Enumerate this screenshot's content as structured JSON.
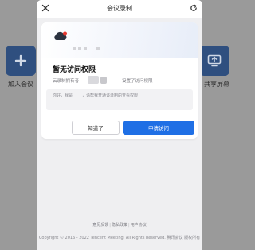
{
  "background": {
    "join_label": "加入会议",
    "share_label": "共享屏幕"
  },
  "dialog": {
    "title": "会议录制"
  },
  "card": {
    "heading": "暂无访问权限",
    "desc_prefix": "云录制拥有者",
    "desc_suffix": "设置了访问权限",
    "note_greeting": "你好，我是",
    "note_message": "，请帮我开通该录制的查看权限",
    "ok_button": "知道了",
    "request_button": "申请访问"
  },
  "footer": {
    "links": [
      "意见反馈",
      "隐私政策",
      "用户协议"
    ],
    "copyright": "Copyright © 2016 - 2022 Tencent Meeting. All Rights Reserved. 腾讯会议 版权所有"
  },
  "colors": {
    "accent": "#1f6fe5",
    "avatar_red": "#e5382f"
  },
  "icons": [
    "close-icon",
    "refresh-icon",
    "cloud-avatar-icon",
    "plus-icon",
    "share-screen-icon"
  ]
}
